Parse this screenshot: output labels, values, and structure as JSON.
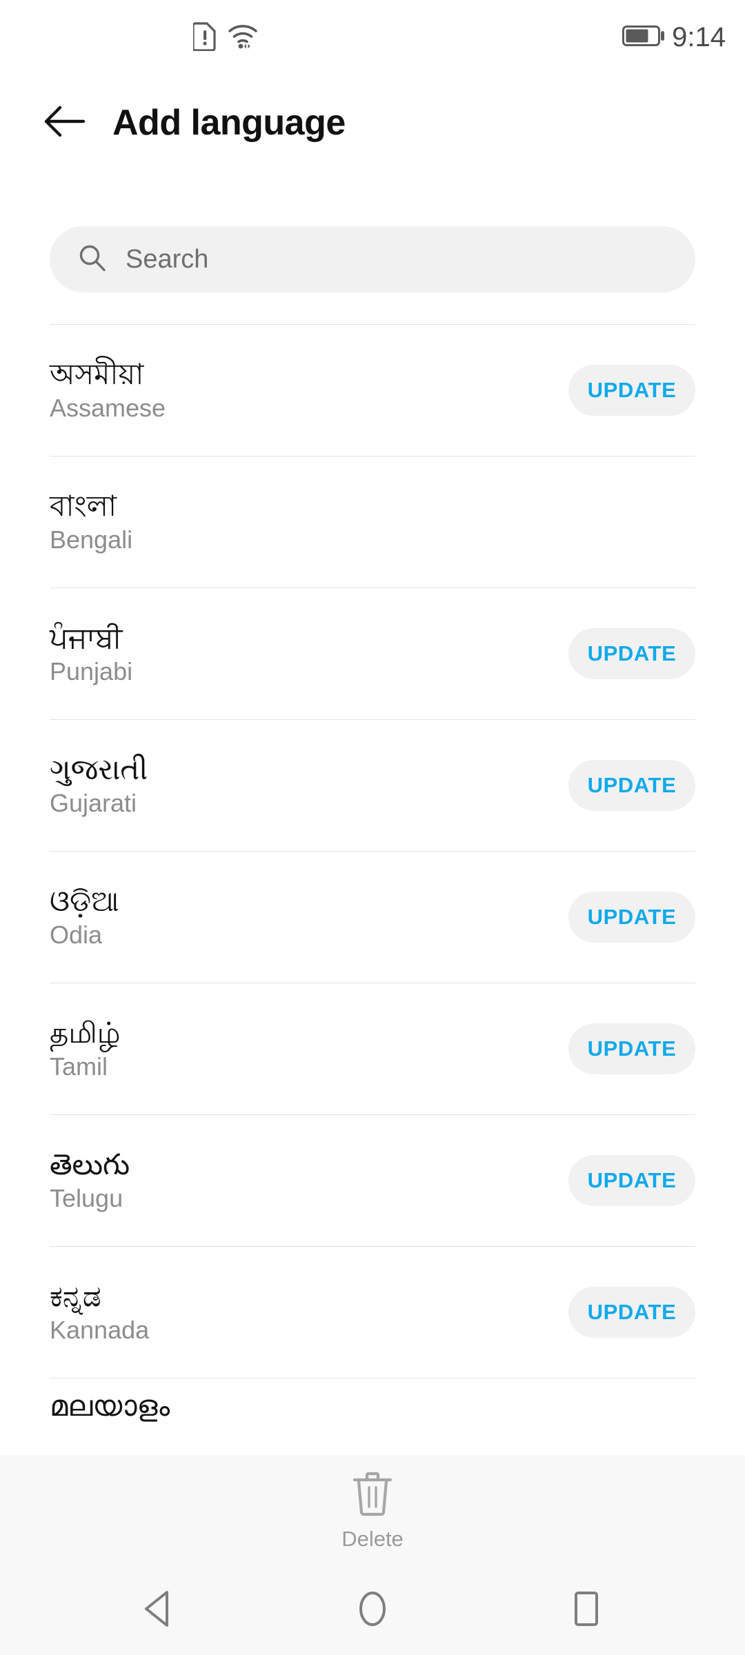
{
  "status_bar": {
    "icons": [
      "sim-card-alert-icon",
      "wifi-icon"
    ],
    "battery_icon": "battery-icon",
    "battery_level_percent": 65,
    "time": "9:14"
  },
  "app_bar": {
    "back_icon": "back-arrow-icon",
    "title": "Add language"
  },
  "search": {
    "icon": "search-icon",
    "placeholder": "Search",
    "value": ""
  },
  "colors": {
    "accent_blue": "#12a9ea",
    "chip_background": "#f1f1f1",
    "divider": "#e3e3e3",
    "secondary_text": "#8c8c8c",
    "bottom_bar_background": "#f8f8f8"
  },
  "languages": [
    {
      "native": "অসমীয়া",
      "english": "Assamese",
      "action": "UPDATE",
      "has_action": true
    },
    {
      "native": "বাংলা",
      "english": "Bengali",
      "action": "",
      "has_action": false
    },
    {
      "native": "ਪੰਜਾਬੀ",
      "english": "Punjabi",
      "action": "UPDATE",
      "has_action": true
    },
    {
      "native": "ગુજરાતી",
      "english": "Gujarati",
      "action": "UPDATE",
      "has_action": true
    },
    {
      "native": "ଓଡ଼ିଆ",
      "english": "Odia",
      "action": "UPDATE",
      "has_action": true
    },
    {
      "native": "தமிழ்",
      "english": "Tamil",
      "action": "UPDATE",
      "has_action": true
    },
    {
      "native": "తెలుగు",
      "english": "Telugu",
      "action": "UPDATE",
      "has_action": true
    },
    {
      "native": "ಕನ್ನಡ",
      "english": "Kannada",
      "action": "UPDATE",
      "has_action": true
    },
    {
      "native": "മലയാളം",
      "english": "",
      "action": "",
      "has_action": false
    }
  ],
  "bottom_bar": {
    "delete_icon": "trash-icon",
    "delete_label": "Delete"
  },
  "nav_bar": {
    "back": "nav-back-icon",
    "home": "nav-home-icon",
    "recents": "nav-recents-icon"
  }
}
